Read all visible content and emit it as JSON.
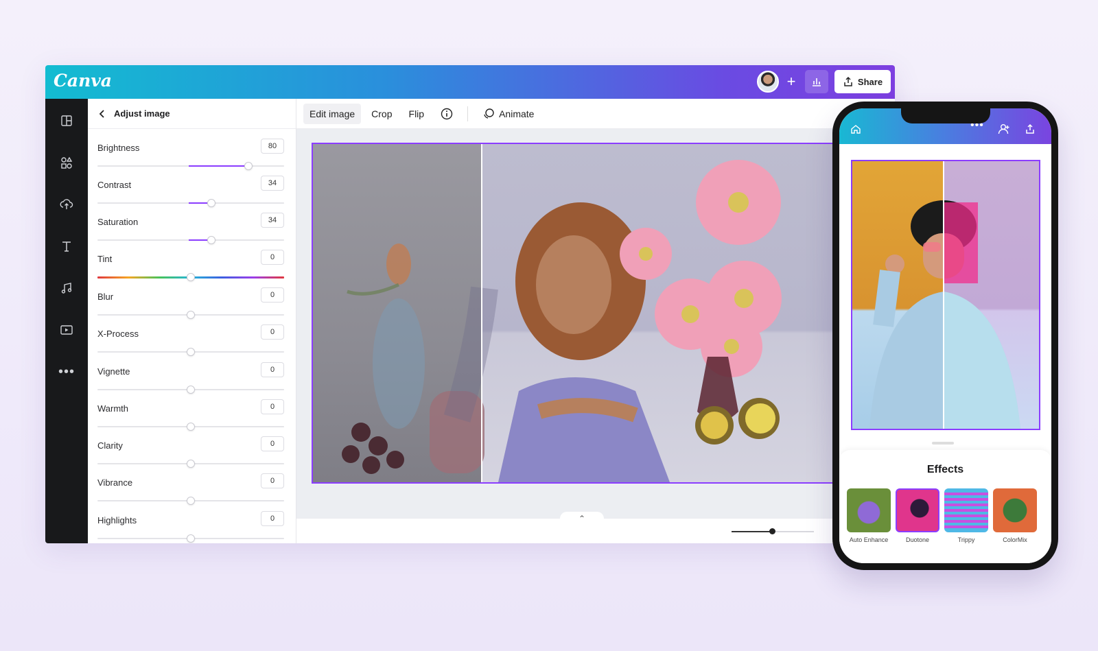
{
  "app": {
    "logo": "Canva"
  },
  "topbar": {
    "share_label": "Share",
    "add_label": "+"
  },
  "rail": {
    "icons": [
      "layout-icon",
      "elements-icon",
      "uploads-icon",
      "text-icon",
      "audio-icon",
      "video-icon",
      "more-icon"
    ]
  },
  "panel": {
    "title": "Adjust image",
    "adjustments": [
      {
        "label": "Brightness",
        "value": "80",
        "level": 0.81
      },
      {
        "label": "Contrast",
        "value": "34",
        "level": 0.61
      },
      {
        "label": "Saturation",
        "value": "34",
        "level": 0.61
      },
      {
        "label": "Tint",
        "value": "0",
        "level": 0.5
      },
      {
        "label": "Blur",
        "value": "0",
        "level": 0.5
      },
      {
        "label": "X-Process",
        "value": "0",
        "level": 0.5
      },
      {
        "label": "Vignette",
        "value": "0",
        "level": 0.5
      },
      {
        "label": "Warmth",
        "value": "0",
        "level": 0.5
      },
      {
        "label": "Clarity",
        "value": "0",
        "level": 0.5
      },
      {
        "label": "Vibrance",
        "value": "0",
        "level": 0.5
      },
      {
        "label": "Highlights",
        "value": "0",
        "level": 0.5
      }
    ]
  },
  "toolbar": {
    "edit_image": "Edit image",
    "crop": "Crop",
    "flip": "Flip",
    "animate": "Animate"
  },
  "phone": {
    "effects_title": "Effects",
    "effects": [
      {
        "label": "Auto Enhance",
        "colors": [
          "#6a8f3a",
          "#8f6ad6"
        ]
      },
      {
        "label": "Duotone",
        "colors": [
          "#2d1a3a",
          "#e0358c"
        ]
      },
      {
        "label": "Trippy",
        "colors": [
          "#4fb8e6",
          "#c84fe0"
        ]
      },
      {
        "label": "ColorMix",
        "colors": [
          "#3d7a3a",
          "#e06a3a"
        ]
      }
    ]
  },
  "colors": {
    "accent": "#8b3dff"
  }
}
